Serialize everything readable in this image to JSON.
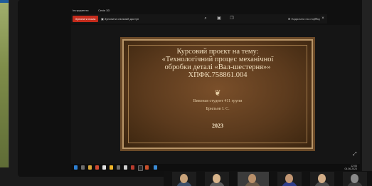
{
  "left_window": {},
  "share_window": {
    "title_items": [
      "Інструменти",
      "Сесія 3D"
    ],
    "toolbar": {
      "stop_share_label": "Зупинити показ",
      "share_mode_label": "Зупинити спільний доступ",
      "right_label": "Надіслати на сторінку"
    },
    "slide": {
      "title_lines": [
        "Курсовий проєкт на тему:",
        "«Технологічний процес механічної",
        "обробки деталі «Вал-шестерня»»",
        "ХПФК.758861.004"
      ],
      "ornament": "❦",
      "author_line1": "Виконав студент 411 групи",
      "author_line2": "Брильов І. С.",
      "year": "2023"
    },
    "taskbar": {
      "clock_time": "12:06",
      "clock_date": "04.06.2023"
    }
  },
  "icons": {
    "search": "search-icon",
    "camera": "camera-icon",
    "minimize": "minimize-icon",
    "close": "close-icon",
    "expand": "expand-icon"
  },
  "colors": {
    "stop_share": "#c42b1c",
    "slide_bg": "#5b3a1d",
    "slide_text": "#f1dfbf"
  },
  "participants": [
    {
      "name": "participant-1"
    },
    {
      "name": "participant-2"
    },
    {
      "name": "participant-3"
    },
    {
      "name": "participant-4"
    },
    {
      "name": "participant-5"
    },
    {
      "name": "participant-6"
    }
  ]
}
